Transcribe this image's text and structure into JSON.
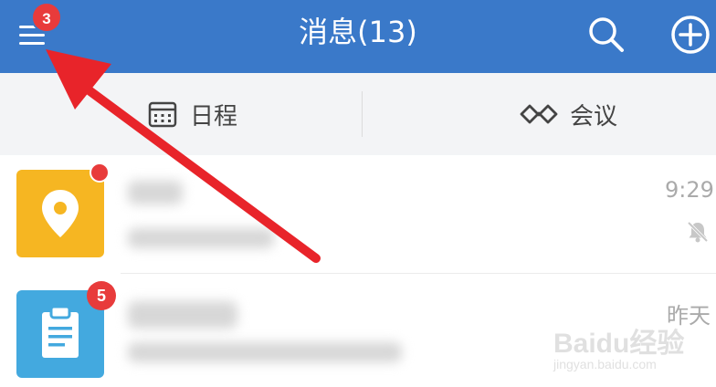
{
  "header": {
    "title": "消息(13)",
    "menu_badge": "3",
    "menu_icon": "hamburger-menu-icon",
    "search_icon": "search-icon",
    "add_icon": "plus-circle-icon",
    "background_color": "#3a79c9"
  },
  "tabs": [
    {
      "label": "日程",
      "icon": "calendar-icon"
    },
    {
      "label": "会议",
      "icon": "meeting-infinity-icon"
    }
  ],
  "messages": [
    {
      "avatar_icon": "location-pin-icon",
      "avatar_color": "#f6b622",
      "time": "9:29",
      "status_icon": "muted-bell-icon",
      "unread_dot": true
    },
    {
      "avatar_icon": "clipboard-icon",
      "avatar_color": "#43a9df",
      "time": "昨天",
      "badge": "5"
    }
  ],
  "watermark": {
    "brand": "Baidu经验",
    "url": "jingyan.baidu.com"
  },
  "colors": {
    "badge": "#e83b3b",
    "annotation_arrow": "#e8242a"
  }
}
